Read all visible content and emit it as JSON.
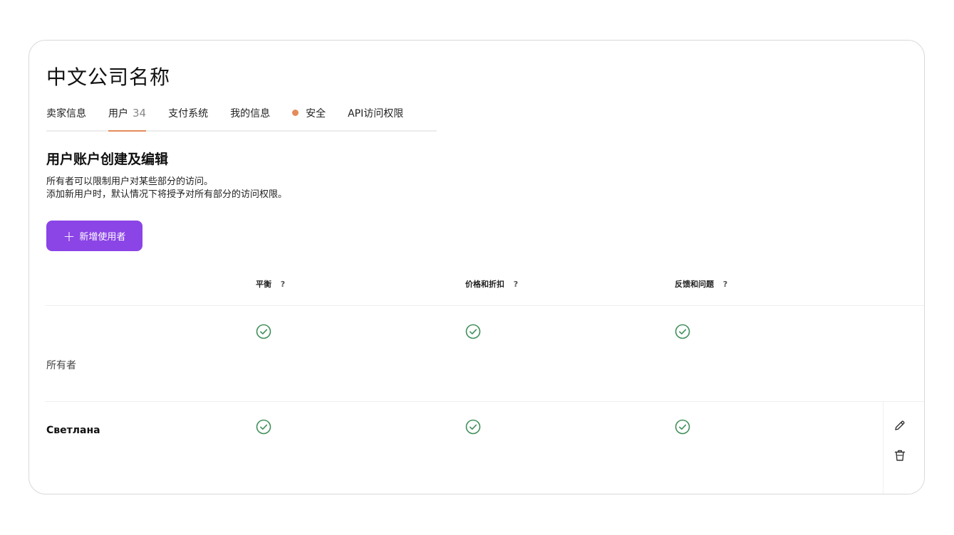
{
  "company": {
    "name": "中文公司名称"
  },
  "tabs": [
    {
      "label": "卖家信息"
    },
    {
      "label": "用户",
      "count": "34",
      "active": true
    },
    {
      "label": "支付系统"
    },
    {
      "label": "我的信息"
    },
    {
      "label": "安全",
      "indicator": "orange-dot"
    },
    {
      "label": "API访问权限"
    }
  ],
  "section": {
    "title": "用户账户创建及编辑",
    "description_line1": "所有者可以限制用户对某些部分的访问。",
    "description_line2": "添加新用户时，默认情况下将授予对所有部分的访问权限。"
  },
  "add_button": {
    "icon": "plus-icon",
    "label": "新增使用者"
  },
  "table": {
    "columns": [
      {
        "label": "平衡",
        "help": "?"
      },
      {
        "label": "价格和折扣",
        "help": "?"
      },
      {
        "label": "反馈和问题",
        "help": "?"
      }
    ],
    "rows": [
      {
        "name": "所有者",
        "permissions": [
          true,
          true,
          true
        ]
      },
      {
        "name": "Светлана",
        "permissions": [
          true,
          true,
          true
        ]
      }
    ]
  },
  "actions": {
    "edit_icon": "pencil-icon",
    "delete_icon": "trash-icon"
  },
  "colors": {
    "accent": "#8b44e6",
    "tab_indicator": "#e58b5a",
    "check": "#3f8f5a"
  }
}
